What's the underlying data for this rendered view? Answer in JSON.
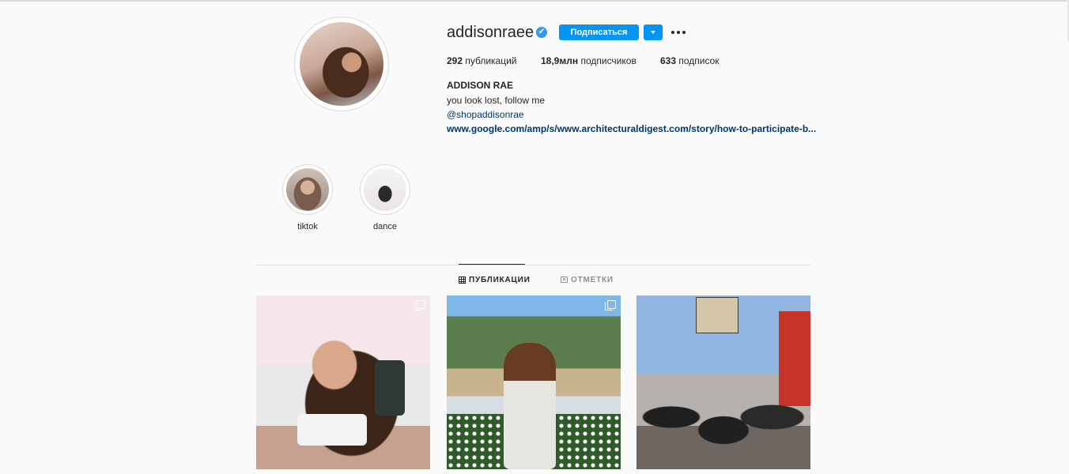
{
  "profile": {
    "username": "addisonraee",
    "verified_mark": "✔",
    "follow_label": "Подписаться",
    "stats": {
      "posts_count": "292",
      "posts_label": "публикаций",
      "followers_count": "18,9млн",
      "followers_label": "подписчиков",
      "following_count": "633",
      "following_label": "подписок"
    },
    "full_name": "ADDISON RAE",
    "bio": "you look lost, follow me",
    "handle": "@shopaddisonrae",
    "website": "www.google.com/amp/s/www.architecturaldigest.com/story/how-to-participate-b..."
  },
  "highlights": [
    {
      "label": "tiktok"
    },
    {
      "label": "dance"
    }
  ],
  "tabs": [
    {
      "label": "ПУБЛИКАЦИИ",
      "active": true
    },
    {
      "label": "ОТМЕТКИ",
      "active": false
    }
  ],
  "posts": [
    {
      "type": "carousel",
      "icon": "multi-photo-icon"
    },
    {
      "type": "carousel",
      "icon": "multi-photo-icon"
    },
    {
      "type": "photo"
    }
  ],
  "colors": {
    "accent": "#0095f6",
    "link": "#00376b",
    "background": "#fafafa",
    "verified": "#3897f0"
  }
}
